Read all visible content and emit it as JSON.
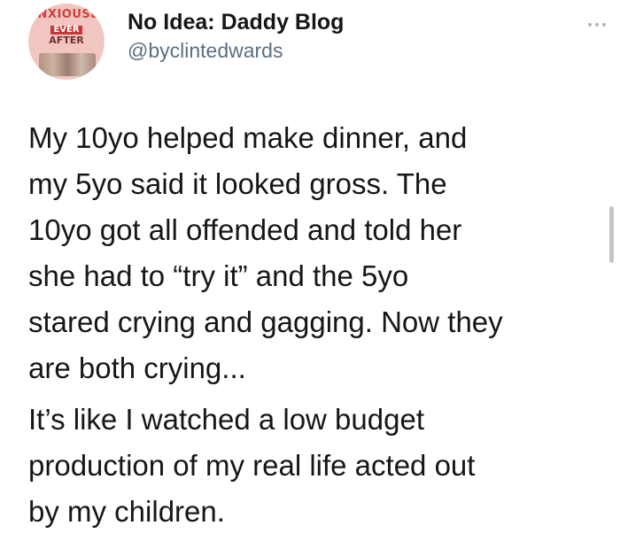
{
  "author": {
    "display_name": "No Idea: Daddy Blog",
    "handle": "@byclintedwards",
    "avatar_text": {
      "line1": "ANXIOUSLY",
      "line2": "EVER",
      "line3": "AFTER"
    }
  },
  "tweet": {
    "paragraphs": [
      "My 10yo helped make dinner, and\nmy 5yo said it looked gross. The\n10yo got all offended and told her\nshe had to “try it” and the 5yo\nstared crying and gagging. Now they\nare both crying...",
      "It’s like I watched a low budget\nproduction of my real life acted out\nby my children."
    ]
  },
  "icons": {
    "more": "more-dots-icon"
  },
  "colors": {
    "text": "#14171a",
    "secondary": "#5b7083",
    "avatar_accent": "#c23a39"
  }
}
